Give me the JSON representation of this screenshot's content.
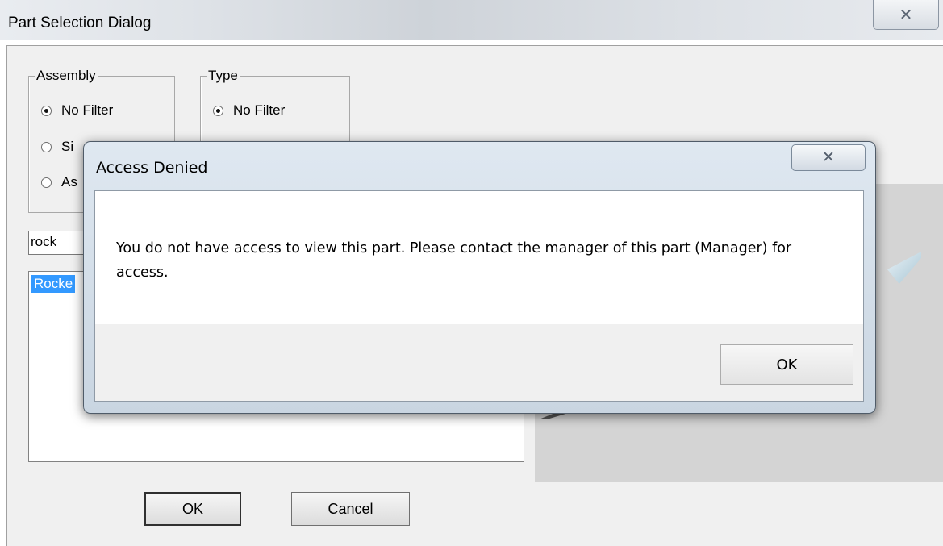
{
  "background_dialog": {
    "title": "Part Selection Dialog",
    "close_glyph": "✕",
    "assembly_group": {
      "label": "Assembly",
      "options": [
        "No Filter",
        "Si",
        "As"
      ],
      "selected_index": 0
    },
    "type_group": {
      "label": "Type",
      "options": [
        "No Filter"
      ],
      "selected_index": 0
    },
    "search": {
      "value": "rock"
    },
    "list": {
      "items": [
        "Rocke"
      ]
    },
    "ok_label": "OK",
    "cancel_label": "Cancel"
  },
  "modal": {
    "title": "Access Denied",
    "close_glyph": "✕",
    "message": "You do not have access to view this part. Please contact the manager of this part (Manager) for access.",
    "ok_label": "OK"
  },
  "colors": {
    "selection": "#3399ff",
    "preview_bg": "#d4d4d4",
    "modal_frame": "#c9d5e1"
  }
}
